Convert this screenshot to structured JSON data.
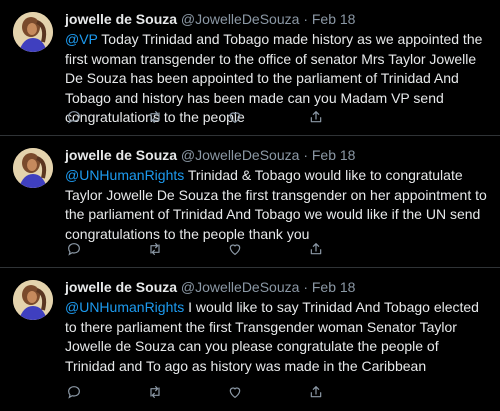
{
  "tweets": [
    {
      "name": "jowelle de Souza",
      "handle": "@JowelleDeSouza",
      "separator": "·",
      "date": "Feb 18",
      "mention": "@VP",
      "text": " Today Trinidad and Tobago made history as we appointed the first woman transgender to the office of senator Mrs Taylor Jowelle De Souza has been appointed to the parliament of Trinidad And Tobago and history has been made can you Madam VP send congratulations to the people"
    },
    {
      "name": "jowelle de Souza",
      "handle": "@JowelleDeSouza",
      "separator": "·",
      "date": "Feb 18",
      "mention": "@UNHumanRights",
      "text": " Trinidad & Tobago would like to congratulate Taylor Jowelle De Souza the first transgender on her appointment to the parliament of Trinidad And Tobago we would like if the UN send congratulations to the people thank you"
    },
    {
      "name": "jowelle de Souza",
      "handle": "@JowelleDeSouza",
      "separator": "·",
      "date": "Feb 18",
      "mention": "@UNHumanRights",
      "text": " I would like to say Trinidad And Tobago elected to there parliament the first Transgender woman Senator Taylor Jowelle de Souza can you please congratulate the people of Trinidad and To ago as history was made in the Caribbean"
    }
  ],
  "colors": {
    "background": "#000000",
    "text": "#e7e9ea",
    "secondary": "#8b98a5",
    "link": "#1d9bf0",
    "divider": "#2f3336"
  },
  "icons": [
    "reply-icon",
    "retweet-icon",
    "like-icon",
    "share-icon"
  ]
}
